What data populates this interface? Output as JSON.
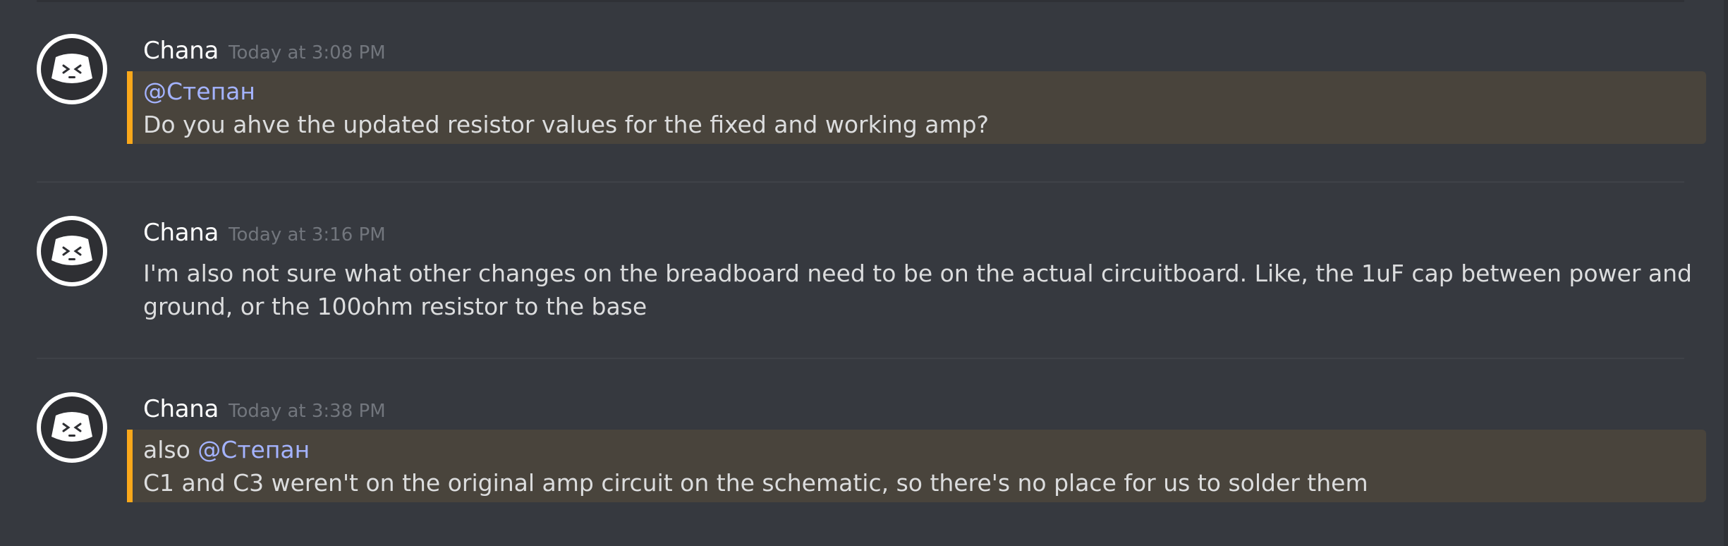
{
  "messages": [
    {
      "author": "Chana",
      "timestamp": "Today at 3:08 PM",
      "line1_mention": "@Степан",
      "line2": "Do you ahve the updated resistor values for the fixed and working amp?"
    },
    {
      "author": "Chana",
      "timestamp": "Today at 3:16 PM",
      "line1": "I'm also not sure what other changes on the breadboard need to be on the actual circuitboard. Like, the 1uF cap between power and",
      "line2": "ground, or the 100ohm resistor to the base"
    },
    {
      "author": "Chana",
      "timestamp": "Today at 3:38 PM",
      "line1_prefix": "also",
      "line1_mention": "@Степан",
      "line2": "C1 and C3 weren't on the original amp circuit on the schematic, so there's no place for us to solder them"
    }
  ],
  "colors": {
    "background": "#36393f",
    "mention_highlight_bg": "#49443c",
    "mention_highlight_bar": "#faa81a",
    "mention_text": "#a4b3ff",
    "username": "#ffffff",
    "timestamp": "#72767d",
    "message_text": "#dcddde"
  },
  "icons": {
    "avatar": "discord-clyde-avatar-icon"
  }
}
